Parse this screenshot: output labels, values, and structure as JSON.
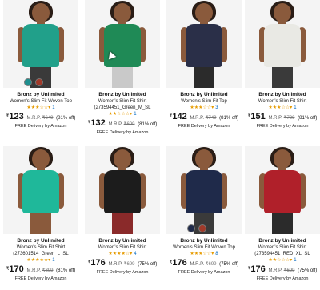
{
  "products": [
    {
      "brand": "Bronz by Unlimited",
      "title_line1": "Women's Slim Fit Woven Top",
      "title_line2": "",
      "stars": "★★★☆☆",
      "rating_count": "1",
      "currency": "₹",
      "price": "123",
      "mrp_label": "M.R.P.",
      "mrp": "₹649",
      "off": "(81% off)",
      "delivery": "FREE Delivery by Amazon",
      "top_color": "#21a08a",
      "legs_color": "#3a3a3a",
      "swatches": [
        "#1e8f8f",
        "#a03a2a"
      ]
    },
    {
      "brand": "Bronz by Unlimited",
      "title_line1": "Women's Slim Fit Shirt",
      "title_line2": "(273594451_Green_M_SL",
      "stars": "★★☆☆☆",
      "rating_count": "1",
      "currency": "₹",
      "price": "132",
      "mrp_label": "M.R.P.",
      "mrp": "₹699",
      "off": "(81% off)",
      "delivery": "FREE Delivery by Amazon",
      "top_color": "#1f8a56",
      "legs_color": "#c9c9c9",
      "swatches": []
    },
    {
      "brand": "Bronz by Unlimited",
      "title_line1": "Women's Slim Fit Top",
      "title_line2": "",
      "stars": "★★★☆☆",
      "rating_count": "3",
      "currency": "₹",
      "price": "142",
      "mrp_label": "M.R.P.",
      "mrp": "₹749",
      "off": "(81% off)",
      "delivery": "FREE Delivery by Amazon",
      "top_color": "#2a2f48",
      "legs_color": "#2b2b2b",
      "swatches": []
    },
    {
      "brand": "Bronz by Unlimited",
      "title_line1": "Women's Slim Fit Shirt",
      "title_line2": "",
      "stars": "★★★☆☆",
      "rating_count": "1",
      "currency": "₹",
      "price": "151",
      "mrp_label": "M.R.P.",
      "mrp": "₹799",
      "off": "(81% off)",
      "delivery": "FREE Delivery by Amazon",
      "top_color": "#e9e9e4",
      "legs_color": "#3a3a3a",
      "swatches": []
    },
    {
      "brand": "Bronz by Unlimited",
      "title_line1": "Women's Slim Fit Shirt",
      "title_line2": "(273601514_Green_L_SL",
      "stars": "★★★★★",
      "rating_count": "1",
      "currency": "₹",
      "price": "170",
      "mrp_label": "M.R.P.",
      "mrp": "₹899",
      "off": "(81% off)",
      "delivery": "FREE Delivery by Amazon",
      "top_color": "#1fb89a",
      "legs_color": "#8a5a3c",
      "swatches": []
    },
    {
      "brand": "Bronz by Unlimited",
      "title_line1": "Women's Slim Fit Shirt",
      "title_line2": "",
      "stars": "★★★★☆",
      "rating_count": "4",
      "currency": "₹",
      "price": "176",
      "mrp_label": "M.R.P.",
      "mrp": "₹699",
      "off": "(75% off)",
      "delivery": "FREE Delivery by Amazon",
      "top_color": "#1c1c1c",
      "legs_color": "#8a2a2a",
      "swatches": []
    },
    {
      "brand": "Bronz by Unlimited",
      "title_line1": "Women's Slim Fit Woven Top",
      "title_line2": "",
      "stars": "★★★☆☆",
      "rating_count": "8",
      "currency": "₹",
      "price": "176",
      "mrp_label": "M.R.P.",
      "mrp": "₹699",
      "off": "(75% off)",
      "delivery": "FREE Delivery by Amazon",
      "top_color": "#1f2a4a",
      "legs_color": "#3a3a3a",
      "swatches": [
        "#1f2a4a",
        "#a03a2a"
      ]
    },
    {
      "brand": "Bronz by Unlimited",
      "title_line1": "Women's Slim Fit Shirt",
      "title_line2": "(273594451_RED_XL_SL",
      "stars": "★★☆☆☆",
      "rating_count": "1",
      "currency": "₹",
      "price": "176",
      "mrp_label": "M.R.P.",
      "mrp": "₹699",
      "off": "(75% off)",
      "delivery": "FREE Delivery by Amazon",
      "top_color": "#b0202a",
      "legs_color": "#2b2b2b",
      "swatches": []
    }
  ]
}
